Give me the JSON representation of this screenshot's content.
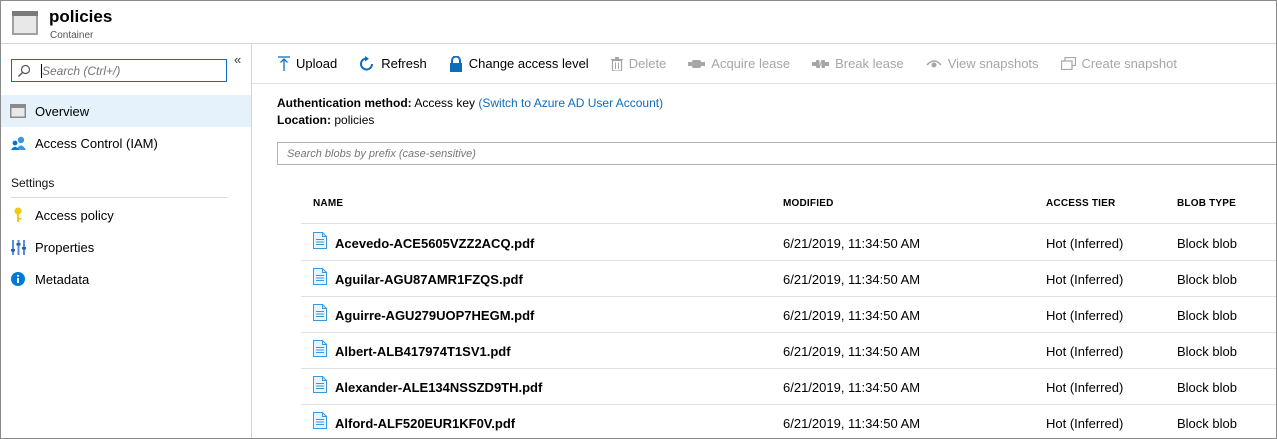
{
  "header": {
    "title": "policies",
    "subtitle": "Container"
  },
  "sidebar": {
    "search_placeholder": "Search (Ctrl+/)",
    "collapse_glyph": "«",
    "items": [
      {
        "label": "Overview",
        "icon": "overview-icon",
        "active": true
      },
      {
        "label": "Access Control (IAM)",
        "icon": "iam-icon"
      }
    ],
    "section": "Settings",
    "settings_items": [
      {
        "label": "Access policy",
        "icon": "key-icon"
      },
      {
        "label": "Properties",
        "icon": "properties-icon"
      },
      {
        "label": "Metadata",
        "icon": "info-icon"
      }
    ]
  },
  "toolbar": {
    "upload": "Upload",
    "refresh": "Refresh",
    "change_access": "Change access level",
    "delete": "Delete",
    "acquire_lease": "Acquire lease",
    "break_lease": "Break lease",
    "view_snapshots": "View snapshots",
    "create_snapshot": "Create snapshot"
  },
  "info": {
    "auth_label": "Authentication method:",
    "auth_value": "Access key",
    "auth_link": "(Switch to Azure AD User Account)",
    "location_label": "Location:",
    "location_value": "policies"
  },
  "blob_search_placeholder": "Search blobs by prefix (case-sensitive)",
  "table": {
    "columns": [
      "NAME",
      "MODIFIED",
      "ACCESS TIER",
      "BLOB TYPE"
    ],
    "rows": [
      {
        "name": "Acevedo-ACE5605VZZ2ACQ.pdf",
        "modified": "6/21/2019, 11:34:50 AM",
        "tier": "Hot (Inferred)",
        "type": "Block blob"
      },
      {
        "name": "Aguilar-AGU87AMR1FZQS.pdf",
        "modified": "6/21/2019, 11:34:50 AM",
        "tier": "Hot (Inferred)",
        "type": "Block blob"
      },
      {
        "name": "Aguirre-AGU279UOP7HEGM.pdf",
        "modified": "6/21/2019, 11:34:50 AM",
        "tier": "Hot (Inferred)",
        "type": "Block blob"
      },
      {
        "name": "Albert-ALB417974T1SV1.pdf",
        "modified": "6/21/2019, 11:34:50 AM",
        "tier": "Hot (Inferred)",
        "type": "Block blob"
      },
      {
        "name": "Alexander-ALE134NSSZD9TH.pdf",
        "modified": "6/21/2019, 11:34:50 AM",
        "tier": "Hot (Inferred)",
        "type": "Block blob"
      },
      {
        "name": "Alford-ALF520EUR1KF0V.pdf",
        "modified": "6/21/2019, 11:34:50 AM",
        "tier": "Hot (Inferred)",
        "type": "Block blob"
      }
    ]
  },
  "colors": {
    "accent": "#0f6cbd",
    "active_nav": "#e5f1fb",
    "disabled": "#a6a6a6"
  }
}
